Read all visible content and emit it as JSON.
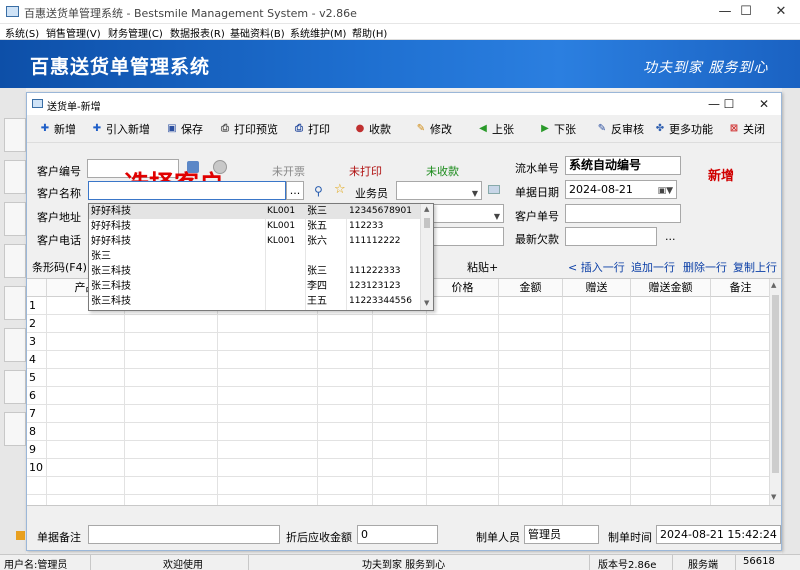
{
  "outer_window": {
    "title": "百惠送货单管理系统 - Bestsmile Management System - v2.86e",
    "minimize": "—",
    "maximize": "☐",
    "close": "✕"
  },
  "menu": [
    "系统(S)",
    "销售管理(V)",
    "财务管理(C)",
    "数据报表(R)",
    "基础资料(B)",
    "系统维护(M)",
    "帮助(H)"
  ],
  "banner": {
    "title": "百惠送货单管理系统",
    "slogan": "功夫到家 服务到心"
  },
  "dialog": {
    "title": "送货单-新增",
    "minimize": "—",
    "maximize": "☐",
    "close": "✕"
  },
  "toolbar": [
    {
      "label": "新增",
      "icon": "plus-icon",
      "glyph": "✚",
      "color": "#1f5fc8"
    },
    {
      "label": "引入新增",
      "icon": "plus-icon",
      "glyph": "✚",
      "color": "#1f5fc8"
    },
    {
      "label": "保存",
      "icon": "save-icon",
      "glyph": "▣",
      "color": "#2b4fa0"
    },
    {
      "label": "打印预览",
      "icon": "print-preview-icon",
      "glyph": "⎙",
      "color": "#555555"
    },
    {
      "label": "打印",
      "icon": "print-icon",
      "glyph": "⎙",
      "color": "#2b4fa0"
    },
    {
      "label": "收款",
      "icon": "collect-icon",
      "glyph": "●",
      "color": "#c03030"
    },
    {
      "label": "修改",
      "icon": "edit-icon",
      "glyph": "✎",
      "color": "#d08a10"
    },
    {
      "label": "上张",
      "icon": "prev-icon",
      "glyph": "◀",
      "color": "#2a9a2a"
    },
    {
      "label": "下张",
      "icon": "next-icon",
      "glyph": "▶",
      "color": "#2a9a2a"
    },
    {
      "label": "反审核",
      "icon": "unaudit-icon",
      "glyph": "✎",
      "color": "#2b4fa0"
    },
    {
      "label": "更多功能",
      "icon": "more-icon",
      "glyph": "✤",
      "color": "#3060b0"
    },
    {
      "label": "关闭",
      "icon": "close-icon",
      "glyph": "⊠",
      "color": "#d03030"
    }
  ],
  "form": {
    "customer_code_label": "客户编号",
    "customer_code_value": "",
    "invoice_status": "未开票",
    "print_status": "未打印",
    "payment_status": "未收款",
    "serial_label": "流水单号",
    "serial_value": "系统自动编号",
    "mode_tag": "新增",
    "customer_name_label": "客户名称",
    "customer_name_value": "",
    "browse_button": "...",
    "salesman_label": "业务员",
    "salesman_value": "",
    "date_label": "单据日期",
    "date_value": "2024-08-21",
    "address_label": "客户地址",
    "address_value": "",
    "customer_order_label": "客户单号",
    "customer_order_value": "",
    "phone_label": "客户电话",
    "phone_value": "",
    "latest_debt_label": "最新欠款",
    "latest_debt_value": "",
    "debt_more": "...",
    "overlay_hint": "选择客户"
  },
  "grid_actions": {
    "barcode_label": "条形码(F4)",
    "paste_label": "粘贴+",
    "insert_row": "< 插入一行",
    "append_row": "追加一行",
    "delete_row": "删除一行",
    "copy_up_row": "复制上行"
  },
  "grid": {
    "headers": [
      "产品",
      "价格",
      "金额",
      "赠送",
      "赠送金额",
      "备注"
    ],
    "rows": [
      "1",
      "2",
      "3",
      "4",
      "5",
      "6",
      "7",
      "8",
      "9",
      "10"
    ]
  },
  "dropdown": [
    {
      "name": "好好科技",
      "code": "KL001",
      "contact": "张三",
      "phone": "12345678901"
    },
    {
      "name": "好好科技",
      "code": "KL001",
      "contact": "张五",
      "phone": "112233"
    },
    {
      "name": "好好科技",
      "code": "KL001",
      "contact": "张六",
      "phone": "111112222"
    },
    {
      "name": "张三",
      "code": "",
      "contact": "",
      "phone": ""
    },
    {
      "name": "张三科技",
      "code": "",
      "contact": "张三",
      "phone": "111222333"
    },
    {
      "name": "张三科技",
      "code": "",
      "contact": "李四",
      "phone": "123123123"
    },
    {
      "name": "张三科技",
      "code": "",
      "contact": "王五",
      "phone": "11223344556"
    }
  ],
  "footer": {
    "remark_label": "单据备注",
    "remark_value": "",
    "receivable_label": "折后应收金额",
    "receivable_value": "0",
    "creator_label": "制单人员",
    "creator_value": "管理员",
    "time_label": "制单时间",
    "time_value": "2024-08-21 15:42:24"
  },
  "statusbar": {
    "user": "用户名:管理员",
    "welcome": "欢迎使用",
    "slogan": "功夫到家 服务到心",
    "version": "版本号2.86e",
    "service": "服务端",
    "port": "56618"
  }
}
